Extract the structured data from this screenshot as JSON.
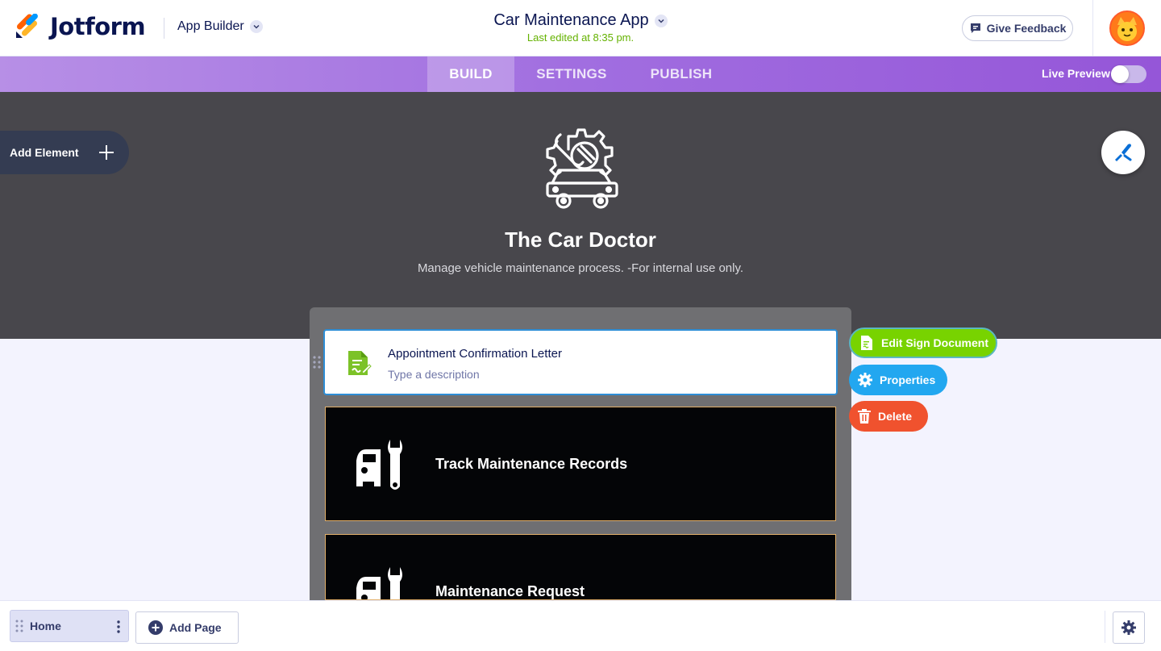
{
  "header": {
    "brand": "Jotform",
    "app_builder_label": "App Builder",
    "app_title": "Car Maintenance App",
    "last_edited": "Last edited at 8:35 pm.",
    "feedback_label": "Give Feedback",
    "icons": [
      "jotform-logo-icon",
      "chevron-down-icon",
      "feedback-icon",
      "avatar"
    ]
  },
  "nav": {
    "tabs": [
      {
        "label": "BUILD",
        "active": true
      },
      {
        "label": "SETTINGS",
        "active": false
      },
      {
        "label": "PUBLISH",
        "active": false
      }
    ],
    "live_preview_label": "Live Preview",
    "live_preview_on": false
  },
  "hero": {
    "add_element_label": "Add Element",
    "title": "The Car Doctor",
    "description": "Manage vehicle maintenance process. -For internal use only.",
    "icons": [
      "car-repair-icon",
      "plus-icon",
      "paint-brush-icon"
    ]
  },
  "elements": [
    {
      "title": "Appointment Confirmation Letter",
      "subtitle": "Type a description",
      "icon": "sign-document-icon",
      "selected": true
    },
    {
      "title": "Track Maintenance Records",
      "icon": "car-wrench-icon"
    },
    {
      "title": "Maintenance Request",
      "icon": "car-wrench-icon"
    }
  ],
  "actions": {
    "edit_label": "Edit Sign Document",
    "properties_label": "Properties",
    "delete_label": "Delete"
  },
  "footer": {
    "home_label": "Home",
    "add_page_label": "Add Page"
  },
  "colors": {
    "brand_navy": "#0a1551",
    "nav_purple": "#a16ee0",
    "hero_bg": "#48474c",
    "edited_green": "#64b200",
    "edit_green": "#78d300",
    "properties_blue": "#22a7f0",
    "delete_red": "#f0522e",
    "selection_blue": "#2e8ed6"
  }
}
